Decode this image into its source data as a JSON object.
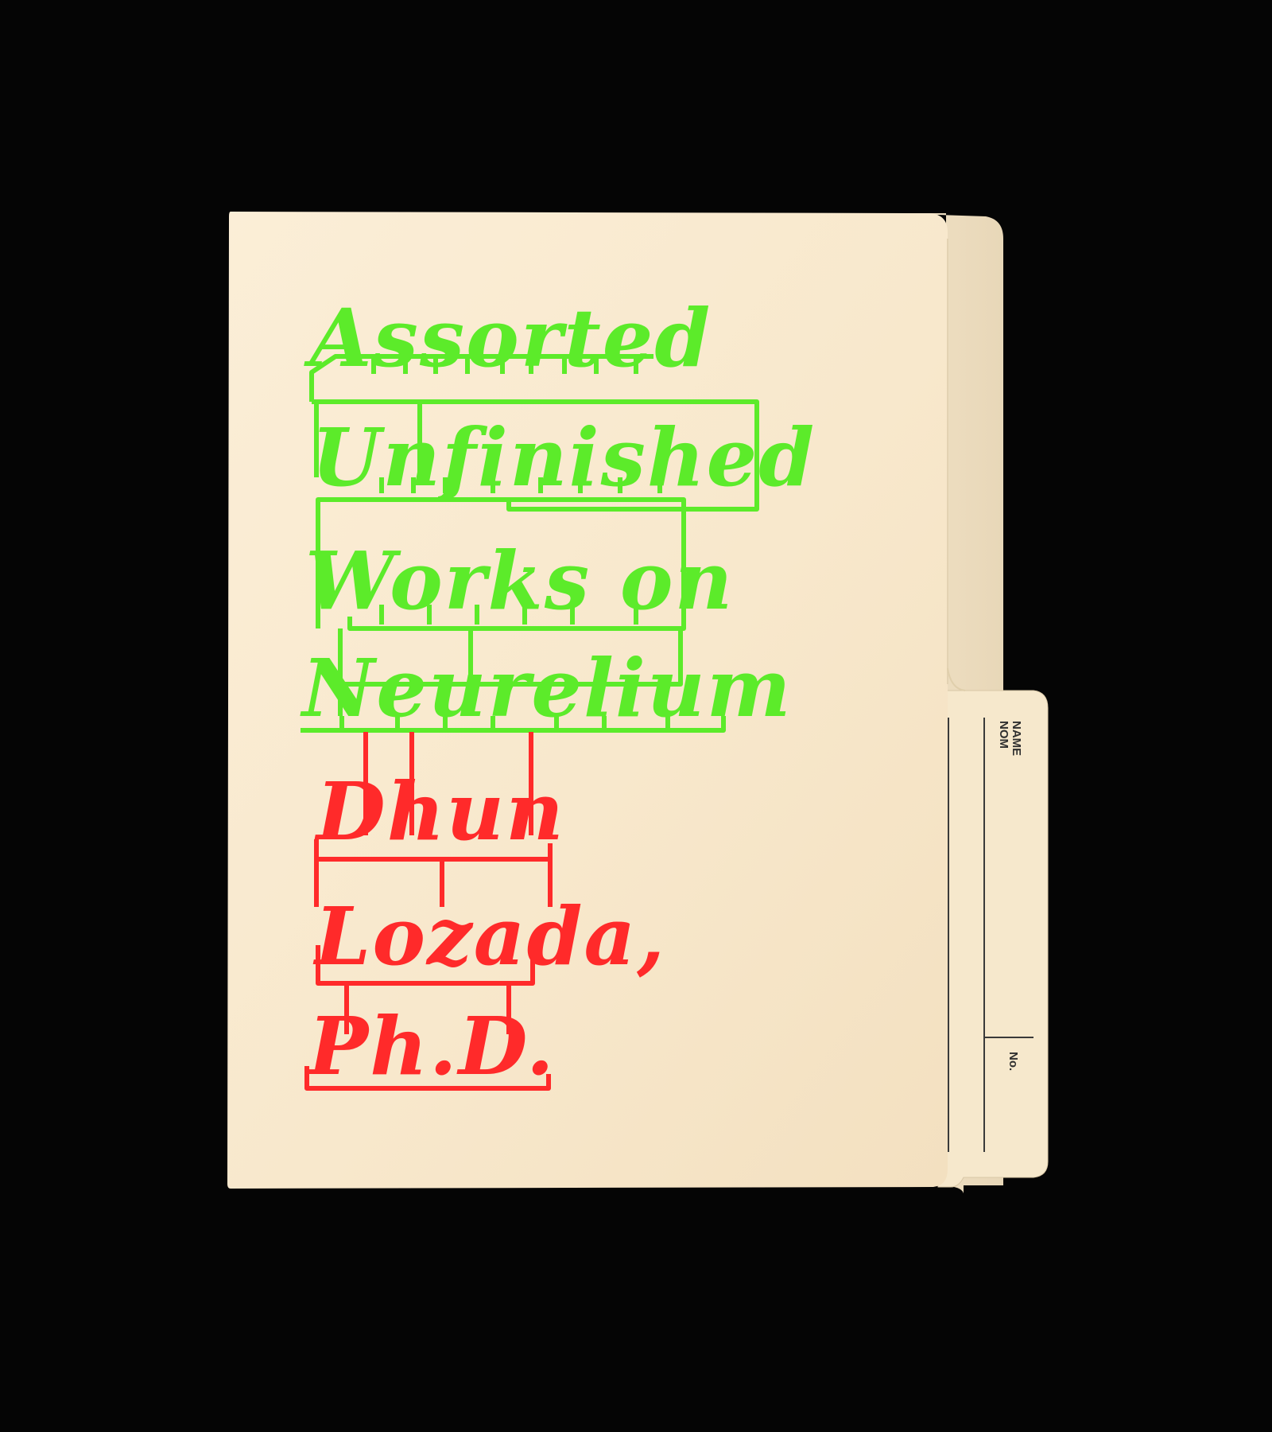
{
  "title_lines": [
    "Assorted",
    "Unfinished",
    "Works on",
    "Neurelium"
  ],
  "author_lines": [
    "Dhun",
    "Lozada,",
    "Ph.D."
  ],
  "tab": {
    "name_label": "NAME",
    "nom_label": "NOM",
    "number_label": "No."
  },
  "colors": {
    "background": "#050505",
    "folder": "#f9ead0",
    "title_green": "#5ceb2a",
    "author_red": "#ff2a2a"
  },
  "icons": [
    "file-folder",
    "sprue-frame"
  ]
}
